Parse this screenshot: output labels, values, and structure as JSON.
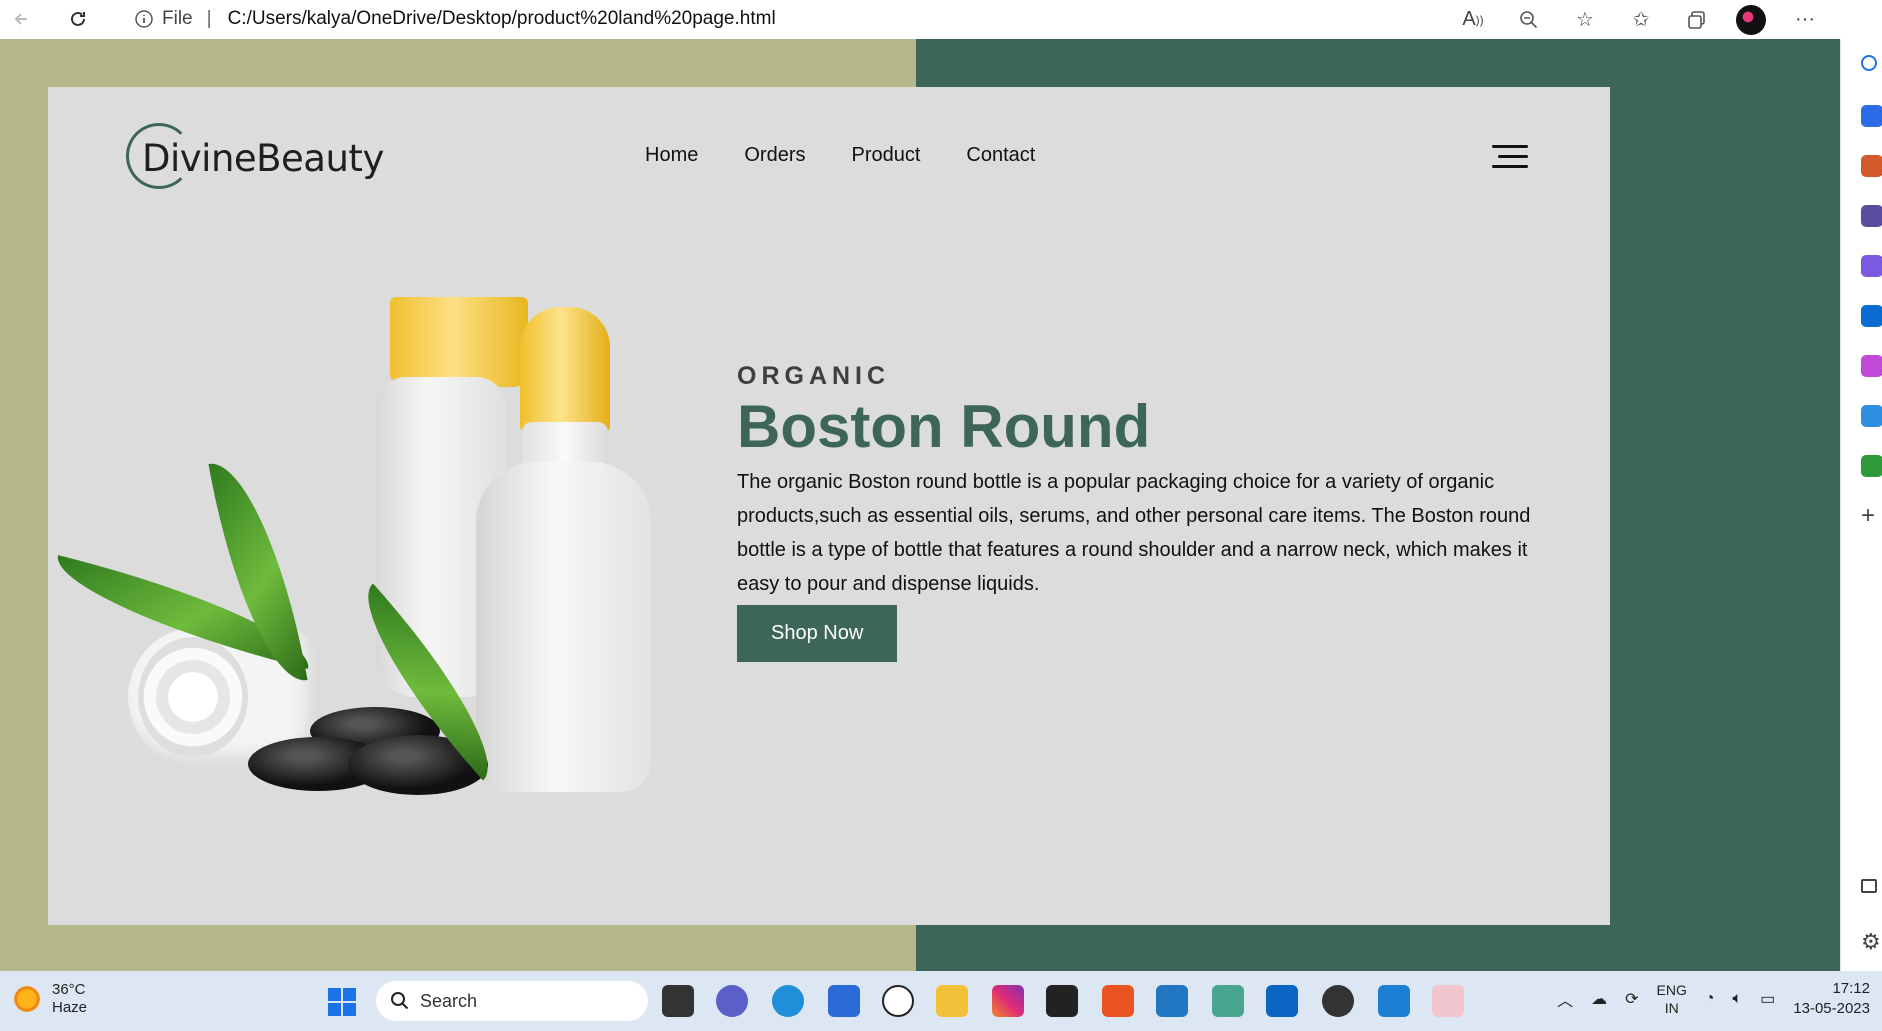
{
  "browser": {
    "file_label": "File",
    "separator": "|",
    "url": "C:/Users/kalya/OneDrive/Desktop/product%20land%20page.html"
  },
  "site": {
    "brand": "DivineBeauty",
    "nav": [
      "Home",
      "Orders",
      "Product",
      "Contact"
    ]
  },
  "hero": {
    "eyebrow": "ORGANIC",
    "title": "Boston Round",
    "description": "The organic Boston round bottle is a popular packaging choice for a variety of organic products,such as essential oils, serums, and other personal care items. The Boston round bottle is a type of bottle that features a round shoulder and a narrow neck, which makes it easy to pour and dispense liquids.",
    "cta": "Shop Now"
  },
  "taskbar": {
    "weather_temp": "36°C",
    "weather_desc": "Haze",
    "search_placeholder": "Search",
    "lang_1": "ENG",
    "lang_2": "IN",
    "time": "17:12",
    "date": "13-05-2023"
  },
  "colors": {
    "accent": "#3d6658",
    "olive": "#b5b68a",
    "card": "#dcdcdc"
  }
}
